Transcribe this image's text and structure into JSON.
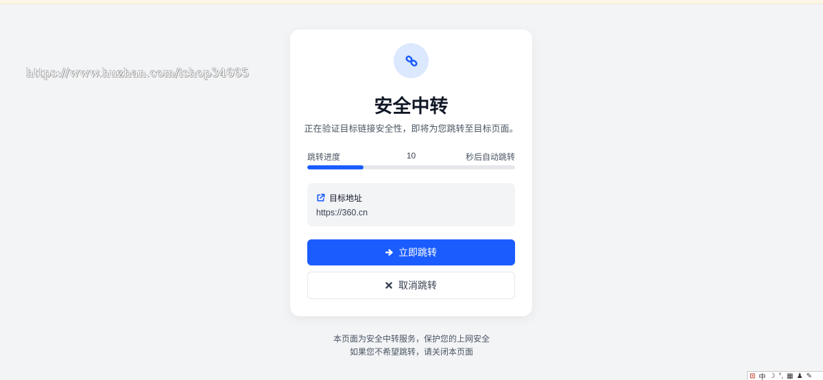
{
  "watermark": "https://www.huzhan.com/ishop34665",
  "card": {
    "title": "安全中转",
    "subtitle": "正在验证目标链接安全性，即将为您跳转至目标页面。",
    "progress": {
      "label": "跳转进度",
      "countdown": "10",
      "suffix": "秒后自动跳转",
      "fraction": 0.27
    },
    "target": {
      "label": "目标地址",
      "url": "https://360.cn"
    },
    "go_button": "立即跳转",
    "cancel_button": "取消跳转"
  },
  "footer": {
    "line1": "本页面为安全中转服务，保护您的上网安全",
    "line2": "如果您不希望跳转，请关闭本页面"
  },
  "ime": {
    "mode": "中",
    "icons": [
      "ime-logo-icon",
      "moon-icon",
      "punctuation-icon",
      "keyboard-icon",
      "user-icon",
      "wrench-icon"
    ]
  },
  "colors": {
    "accent": "#1b5cff",
    "icon_bg": "#dbe8fe",
    "page_bg": "#f3f4f6"
  }
}
